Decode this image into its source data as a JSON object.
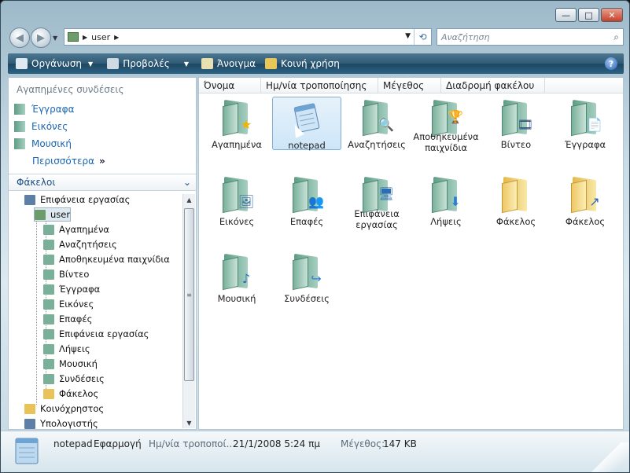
{
  "window": {
    "min_icon": "min-icon",
    "max_icon": "max-icon",
    "close_icon": "close-icon",
    "min": "—",
    "max": "□",
    "close": "✕"
  },
  "address": {
    "path": "user"
  },
  "search": {
    "placeholder": "Αναζήτηση"
  },
  "toolbar": {
    "organize": "Οργάνωση",
    "views": "Προβολές",
    "open": "Άνοιγμα",
    "share": "Κοινή χρήση",
    "help": "?"
  },
  "favorites": {
    "header": "Αγαπημένες συνδέσεις",
    "items": [
      {
        "label": "Έγγραφα",
        "icon": "documents-icon"
      },
      {
        "label": "Εικόνες",
        "icon": "pictures-icon"
      },
      {
        "label": "Μουσική",
        "icon": "music-icon"
      }
    ],
    "more": "Περισσότερα"
  },
  "folders": {
    "header": "Φάκελοι",
    "tree": [
      {
        "label": "Επιφάνεια εργασίας",
        "icon": "desktop-icon",
        "level": 0
      },
      {
        "label": "user",
        "icon": "user-folder-icon",
        "level": 1,
        "selected": true
      },
      {
        "label": "Αγαπημένα",
        "icon": "favorites-folder-icon",
        "level": 2
      },
      {
        "label": "Αναζητήσεις",
        "icon": "searches-folder-icon",
        "level": 2
      },
      {
        "label": "Αποθηκευμένα παιχνίδια",
        "icon": "saved-games-icon",
        "level": 2
      },
      {
        "label": "Βίντεο",
        "icon": "videos-folder-icon",
        "level": 2
      },
      {
        "label": "Έγγραφα",
        "icon": "documents-folder-icon",
        "level": 2
      },
      {
        "label": "Εικόνες",
        "icon": "pictures-folder-icon",
        "level": 2
      },
      {
        "label": "Επαφές",
        "icon": "contacts-folder-icon",
        "level": 2
      },
      {
        "label": "Επιφάνεια εργασίας",
        "icon": "desktop-folder-icon",
        "level": 2
      },
      {
        "label": "Λήψεις",
        "icon": "downloads-folder-icon",
        "level": 2
      },
      {
        "label": "Μουσική",
        "icon": "music-folder-icon",
        "level": 2
      },
      {
        "label": "Συνδέσεις",
        "icon": "links-folder-icon",
        "level": 2
      },
      {
        "label": "Φάκελος",
        "icon": "folder-icon",
        "level": 2
      },
      {
        "label": "Κοινόχρηστος",
        "icon": "public-folder-icon",
        "level": 0
      },
      {
        "label": "Υπολογιστής",
        "icon": "computer-icon",
        "level": 0
      }
    ]
  },
  "columns": [
    "Όνομα",
    "Ημ/νία τροποποίησης",
    "Μέγεθος",
    "Διαδρομή φακέλου"
  ],
  "items": [
    {
      "label": "Αγαπημένα",
      "badge": "★",
      "badge_color": "#f0b400",
      "icon": "favorites-folder-icon"
    },
    {
      "label": "notepad",
      "badge": "",
      "badge_color": "#3a7bd5",
      "icon": "notepad-icon",
      "selected": true
    },
    {
      "label": "Αναζητήσεις",
      "badge": "🔍",
      "badge_color": "#5a8ab5",
      "icon": "searches-folder-icon"
    },
    {
      "label": "Αποθηκευμένα παιχνίδια",
      "badge": "🏆",
      "badge_color": "#c77d2a",
      "icon": "saved-games-icon"
    },
    {
      "label": "Βίντεο",
      "badge": "🎞",
      "badge_color": "#2a4f7a",
      "icon": "videos-folder-icon"
    },
    {
      "label": "Έγγραφα",
      "badge": "📄",
      "badge_color": "#6a7f92",
      "icon": "documents-folder-icon"
    },
    {
      "label": "Εικόνες",
      "badge": "🖼",
      "badge_color": "#3a6aa0",
      "icon": "pictures-folder-icon"
    },
    {
      "label": "Επαφές",
      "badge": "👥",
      "badge_color": "#4c8a4c",
      "icon": "contacts-folder-icon"
    },
    {
      "label": "Επιφάνεια εργασίας",
      "badge": "🖥",
      "badge_color": "#2c6cb5",
      "icon": "desktop-folder-icon"
    },
    {
      "label": "Λήψεις",
      "badge": "⬇",
      "badge_color": "#2a7fd5",
      "icon": "downloads-folder-icon"
    },
    {
      "label": "Φάκελος",
      "badge": "",
      "badge_color": "#e8c35a",
      "icon": "folder-icon",
      "yellow": true
    },
    {
      "label": "Φάκελος",
      "badge": "↗",
      "badge_color": "#2a62b7",
      "icon": "folder-shortcut-icon",
      "yellow": true
    },
    {
      "label": "Μουσική",
      "badge": "♪",
      "badge_color": "#2a6fc0",
      "icon": "music-folder-icon"
    },
    {
      "label": "Συνδέσεις",
      "badge": "↪",
      "badge_color": "#2a7fd5",
      "icon": "links-folder-icon"
    }
  ],
  "status": {
    "name": "notepad",
    "type": "Εφαρμογή",
    "date_label": "Ημ/νία τροποποί...",
    "date": "21/1/2008 5:24 πμ",
    "size_label": "Μέγεθος:",
    "size": "147 KB"
  }
}
